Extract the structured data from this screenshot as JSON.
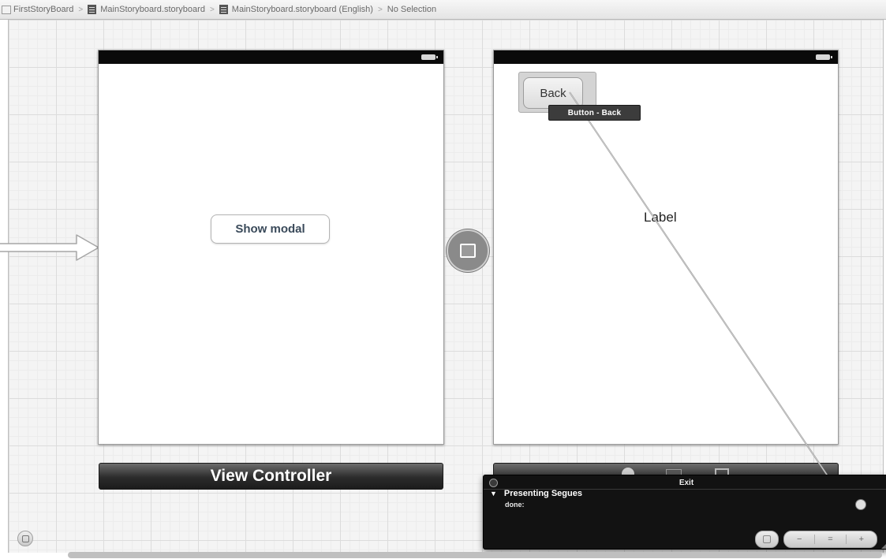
{
  "breadcrumb": {
    "project": "FirstStoryBoard",
    "file": "MainStoryboard.storyboard",
    "localized_file": "MainStoryboard.storyboard (English)",
    "selection": "No Selection",
    "separator": ">"
  },
  "scene1": {
    "button_label": "Show modal",
    "dock_title": "View Controller"
  },
  "scene2": {
    "button_label": "Back",
    "tooltip": "Button - Back",
    "label_text": "Label"
  },
  "exit_popover": {
    "title": "Exit",
    "section": "Presenting Segues",
    "item": "done:"
  },
  "icons": [
    "document-icon",
    "battery-icon",
    "segue-modal-icon",
    "zoom-in-icon",
    "zoom-fit-icon",
    "zoom-out-icon",
    "first-responder-icon",
    "exit-icon"
  ],
  "colors": {
    "status_bar": "#0a0a0a",
    "dock": "#2b2b2b",
    "popover": "#121212",
    "canvas_grid": "#dcdcdc"
  }
}
